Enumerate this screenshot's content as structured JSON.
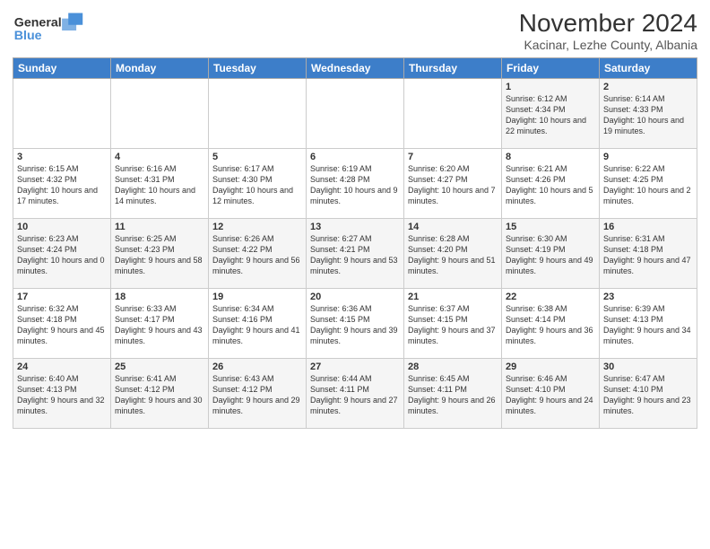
{
  "header": {
    "logo_general": "General",
    "logo_blue": "Blue",
    "month_title": "November 2024",
    "location": "Kacinar, Lezhe County, Albania"
  },
  "days_of_week": [
    "Sunday",
    "Monday",
    "Tuesday",
    "Wednesday",
    "Thursday",
    "Friday",
    "Saturday"
  ],
  "weeks": [
    {
      "days": [
        {
          "num": "",
          "info": ""
        },
        {
          "num": "",
          "info": ""
        },
        {
          "num": "",
          "info": ""
        },
        {
          "num": "",
          "info": ""
        },
        {
          "num": "",
          "info": ""
        },
        {
          "num": "1",
          "info": "Sunrise: 6:12 AM\nSunset: 4:34 PM\nDaylight: 10 hours and 22 minutes."
        },
        {
          "num": "2",
          "info": "Sunrise: 6:14 AM\nSunset: 4:33 PM\nDaylight: 10 hours and 19 minutes."
        }
      ]
    },
    {
      "days": [
        {
          "num": "3",
          "info": "Sunrise: 6:15 AM\nSunset: 4:32 PM\nDaylight: 10 hours and 17 minutes."
        },
        {
          "num": "4",
          "info": "Sunrise: 6:16 AM\nSunset: 4:31 PM\nDaylight: 10 hours and 14 minutes."
        },
        {
          "num": "5",
          "info": "Sunrise: 6:17 AM\nSunset: 4:30 PM\nDaylight: 10 hours and 12 minutes."
        },
        {
          "num": "6",
          "info": "Sunrise: 6:19 AM\nSunset: 4:28 PM\nDaylight: 10 hours and 9 minutes."
        },
        {
          "num": "7",
          "info": "Sunrise: 6:20 AM\nSunset: 4:27 PM\nDaylight: 10 hours and 7 minutes."
        },
        {
          "num": "8",
          "info": "Sunrise: 6:21 AM\nSunset: 4:26 PM\nDaylight: 10 hours and 5 minutes."
        },
        {
          "num": "9",
          "info": "Sunrise: 6:22 AM\nSunset: 4:25 PM\nDaylight: 10 hours and 2 minutes."
        }
      ]
    },
    {
      "days": [
        {
          "num": "10",
          "info": "Sunrise: 6:23 AM\nSunset: 4:24 PM\nDaylight: 10 hours and 0 minutes."
        },
        {
          "num": "11",
          "info": "Sunrise: 6:25 AM\nSunset: 4:23 PM\nDaylight: 9 hours and 58 minutes."
        },
        {
          "num": "12",
          "info": "Sunrise: 6:26 AM\nSunset: 4:22 PM\nDaylight: 9 hours and 56 minutes."
        },
        {
          "num": "13",
          "info": "Sunrise: 6:27 AM\nSunset: 4:21 PM\nDaylight: 9 hours and 53 minutes."
        },
        {
          "num": "14",
          "info": "Sunrise: 6:28 AM\nSunset: 4:20 PM\nDaylight: 9 hours and 51 minutes."
        },
        {
          "num": "15",
          "info": "Sunrise: 6:30 AM\nSunset: 4:19 PM\nDaylight: 9 hours and 49 minutes."
        },
        {
          "num": "16",
          "info": "Sunrise: 6:31 AM\nSunset: 4:18 PM\nDaylight: 9 hours and 47 minutes."
        }
      ]
    },
    {
      "days": [
        {
          "num": "17",
          "info": "Sunrise: 6:32 AM\nSunset: 4:18 PM\nDaylight: 9 hours and 45 minutes."
        },
        {
          "num": "18",
          "info": "Sunrise: 6:33 AM\nSunset: 4:17 PM\nDaylight: 9 hours and 43 minutes."
        },
        {
          "num": "19",
          "info": "Sunrise: 6:34 AM\nSunset: 4:16 PM\nDaylight: 9 hours and 41 minutes."
        },
        {
          "num": "20",
          "info": "Sunrise: 6:36 AM\nSunset: 4:15 PM\nDaylight: 9 hours and 39 minutes."
        },
        {
          "num": "21",
          "info": "Sunrise: 6:37 AM\nSunset: 4:15 PM\nDaylight: 9 hours and 37 minutes."
        },
        {
          "num": "22",
          "info": "Sunrise: 6:38 AM\nSunset: 4:14 PM\nDaylight: 9 hours and 36 minutes."
        },
        {
          "num": "23",
          "info": "Sunrise: 6:39 AM\nSunset: 4:13 PM\nDaylight: 9 hours and 34 minutes."
        }
      ]
    },
    {
      "days": [
        {
          "num": "24",
          "info": "Sunrise: 6:40 AM\nSunset: 4:13 PM\nDaylight: 9 hours and 32 minutes."
        },
        {
          "num": "25",
          "info": "Sunrise: 6:41 AM\nSunset: 4:12 PM\nDaylight: 9 hours and 30 minutes."
        },
        {
          "num": "26",
          "info": "Sunrise: 6:43 AM\nSunset: 4:12 PM\nDaylight: 9 hours and 29 minutes."
        },
        {
          "num": "27",
          "info": "Sunrise: 6:44 AM\nSunset: 4:11 PM\nDaylight: 9 hours and 27 minutes."
        },
        {
          "num": "28",
          "info": "Sunrise: 6:45 AM\nSunset: 4:11 PM\nDaylight: 9 hours and 26 minutes."
        },
        {
          "num": "29",
          "info": "Sunrise: 6:46 AM\nSunset: 4:10 PM\nDaylight: 9 hours and 24 minutes."
        },
        {
          "num": "30",
          "info": "Sunrise: 6:47 AM\nSunset: 4:10 PM\nDaylight: 9 hours and 23 minutes."
        }
      ]
    }
  ]
}
